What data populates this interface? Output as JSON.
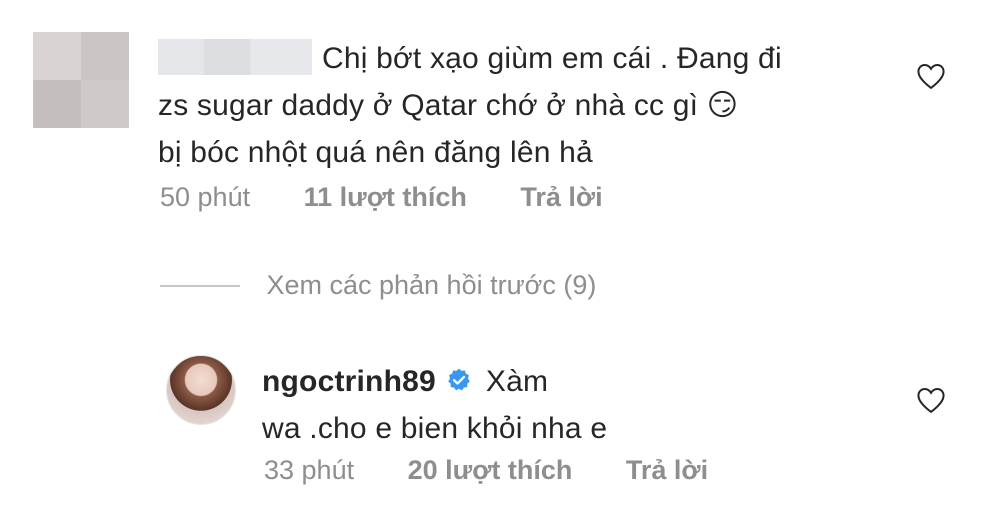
{
  "comments": [
    {
      "avatar": "blurred-avatar",
      "text_line1": "Chị bớt xạo giùm em cái . Đang đi",
      "text_line2": "zs sugar daddy ở Qatar chớ ở nhà cc gì 😏",
      "text_line3": "bị bóc nhột quá nên đăng lên hả",
      "time": "50 phút",
      "likes": "11 lượt thích",
      "reply_label": "Trả lời"
    }
  ],
  "view_previous": "Xem các phản hồi trước (9)",
  "reply": {
    "username": "ngoctrinh89",
    "text_line1": "Xàm",
    "text_line2": "wa .cho e bien khỏi nha e",
    "time": "33 phút",
    "likes": "20 lượt thích",
    "reply_label": "Trả lời",
    "verified_color": "#3897f0"
  },
  "icons": {
    "like": "heart-outline-icon",
    "verified": "verified-badge-icon"
  }
}
